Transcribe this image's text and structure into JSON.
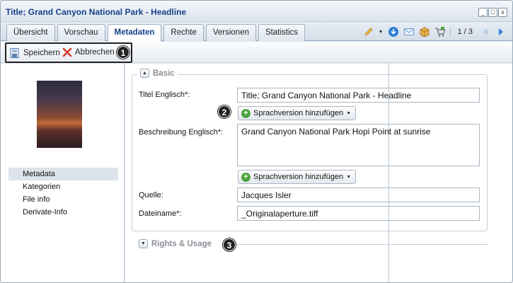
{
  "window": {
    "title": "Title; Grand Canyon National Park - Headline",
    "controls": [
      "_",
      "□",
      "x"
    ]
  },
  "tabs": [
    {
      "label": "Übersicht",
      "active": false
    },
    {
      "label": "Vorschau",
      "active": false
    },
    {
      "label": "Metadaten",
      "active": true
    },
    {
      "label": "Rechte",
      "active": false
    },
    {
      "label": "Versionen",
      "active": false
    },
    {
      "label": "Statistics",
      "active": false
    }
  ],
  "tab_tools": {
    "icons": [
      "pencil-icon",
      "download-icon",
      "mail-icon",
      "package-icon",
      "cart-icon",
      "prev-icon",
      "next-icon"
    ],
    "pager": "1 / 3"
  },
  "toolbar": {
    "save_label": "Speichern",
    "cancel_label": "Abbrechen"
  },
  "callouts": [
    "1",
    "2",
    "3"
  ],
  "left_nav": [
    {
      "label": "Metadata",
      "active": true
    },
    {
      "label": "Kategorien",
      "active": false
    },
    {
      "label": "File info",
      "active": false
    },
    {
      "label": "Derivate-Info",
      "active": false
    }
  ],
  "basic": {
    "legend": "Basic",
    "title_label": "Titel Englisch*:",
    "title_value": "Title; Grand Canyon National Park - Headline",
    "add_language_label": "Sprachversion hinzufügen",
    "description_label": "Beschreibung Englisch*:",
    "description_value": "Grand Canyon National Park Hopi Point at sunrise",
    "source_label": "Quelle:",
    "source_value": "Jacques Isler",
    "filename_label": "Dateiname*:",
    "filename_value": "_Originalaperture.tiff"
  },
  "rights": {
    "legend": "Rights & Usage"
  },
  "colors": {
    "title_blue": "#15428b",
    "accent_blue": "#2f7fd6",
    "add_green": "#4aa53c"
  }
}
